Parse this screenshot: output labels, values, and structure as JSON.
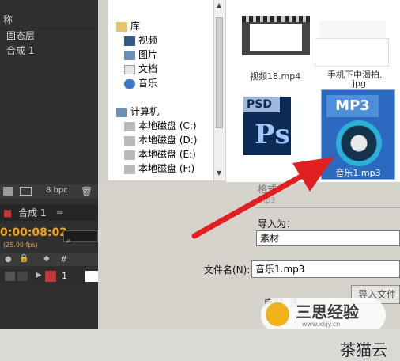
{
  "ae": {
    "header_fragment": "称",
    "rows": [
      "固态层",
      "合成 1"
    ],
    "bpc": "8 bpc",
    "comp_tab": "合成 1",
    "timecode": "0:00:08:02",
    "fps": "(25.00 fps)",
    "hash": "#",
    "layer_number": "1"
  },
  "tree": {
    "library": "库",
    "items": [
      "视频",
      "图片",
      "文档",
      "音乐"
    ],
    "computer": "计算机",
    "drives": [
      "本地磁盘 (C:)",
      "本地磁盘 (D:)",
      "本地磁盘 (E:)",
      "本地磁盘 (F:)"
    ]
  },
  "files": {
    "top_left_label": "视频18.mp4",
    "top_right_label1": "手机下中渴拍.",
    "top_right_label2": "jpg",
    "psd_badge": "PSD",
    "mp3_badge": "MP3",
    "mp3_label": "音乐1.mp3"
  },
  "dialog": {
    "format_label": "格式：",
    "format_value": "mp3",
    "import_as_label": "导入为：",
    "import_as_value": "素材",
    "filename_label": "文件名(N):",
    "filename_value": "音乐1.mp3",
    "import_button": "导入文件",
    "sequence_fragment": "序列: 选"
  },
  "watermark": {
    "brand": "三思经验",
    "url": "www.xsjy.cn",
    "corner": "茶猫云"
  },
  "colors": {
    "arrow": "#e02020",
    "timecode": "#f2a21b",
    "mp3_bg": "#1a6bc4",
    "psd_bg": "#0b2a55"
  }
}
